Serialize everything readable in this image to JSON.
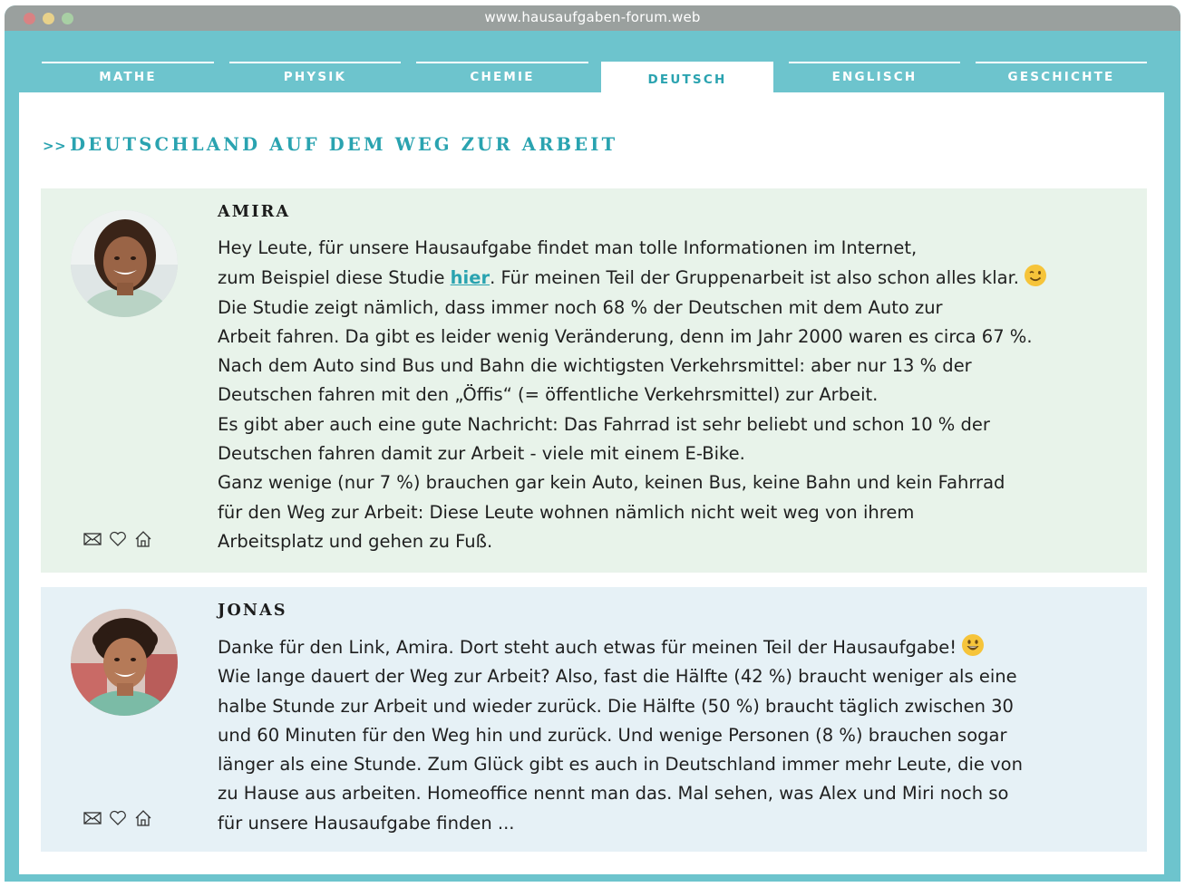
{
  "browser": {
    "url": "www.hausaufgaben-forum.web"
  },
  "tabs": [
    "MATHE",
    "PHYSIK",
    "CHEMIE",
    "DEUTSCH",
    "ENGLISCH",
    "GESCHICHTE"
  ],
  "active_tab": "DEUTSCH",
  "heading": {
    "arrows": ">>",
    "title": "DEUTSCHLAND AUF DEM WEG ZUR ARBEIT"
  },
  "posts": [
    {
      "author": "AMIRA",
      "lines": [
        "Hey Leute, für unsere Hausaufgabe findet man tolle Informationen im Internet,",
        "zum Beispiel diese Studie ",
        "hier",
        ". Für meinen Teil der Gruppenarbeit ist also schon alles klar.",
        "Die Studie zeigt nämlich, dass immer noch 68 % der Deutschen mit dem Auto zur",
        "Arbeit fahren. Da gibt es leider wenig Veränderung, denn im Jahr 2000 waren es circa 67 %.",
        "Nach dem Auto sind Bus und Bahn die wichtigsten Verkehrsmittel: aber nur 13 % der",
        "Deutschen fahren mit den „Öffis“ (= öffentliche Verkehrsmittel) zur Arbeit.",
        "Es gibt aber auch eine gute Nachricht: Das Fahrrad ist sehr beliebt und schon 10 % der",
        "Deutschen fahren damit zur Arbeit - viele mit einem E-Bike.",
        "Ganz wenige (nur 7 %) brauchen gar kein Auto, keinen Bus, keine Bahn und kein Fahrrad",
        "für den Weg zur Arbeit: Diese Leute wohnen nämlich nicht weit weg von ihrem",
        "Arbeitsplatz und gehen zu Fuß."
      ]
    },
    {
      "author": "JONAS",
      "lines": [
        "Danke für den Link, Amira. Dort steht auch etwas für meinen Teil der Hausaufgabe!",
        "Wie lange dauert der Weg zur Arbeit? Also, fast die Hälfte (42 %) braucht weniger als eine",
        "halbe Stunde zur Arbeit und wieder zurück. Die Hälfte (50 %) braucht täglich zwischen 30",
        "und 60 Minuten für den Weg hin und zurück. Und wenige Personen (8 %) brauchen sogar",
        "länger als eine Stunde. Zum Glück gibt es auch in Deutschland immer mehr Leute, die von",
        "zu Hause aus arbeiten. Homeoffice nennt man das. Mal sehen, was Alex und Miri noch so",
        "für unsere Hausaufgabe finden ..."
      ]
    }
  ],
  "colors": {
    "frame": "#6dc4cd",
    "accent": "#2aa3b0",
    "post_green_bg": "#e8f3ea",
    "post_blue_bg": "#e6f1f6"
  },
  "icons": [
    "mail-icon",
    "heart-icon",
    "home-icon",
    "wink-emoji-icon",
    "grin-emoji-icon"
  ]
}
